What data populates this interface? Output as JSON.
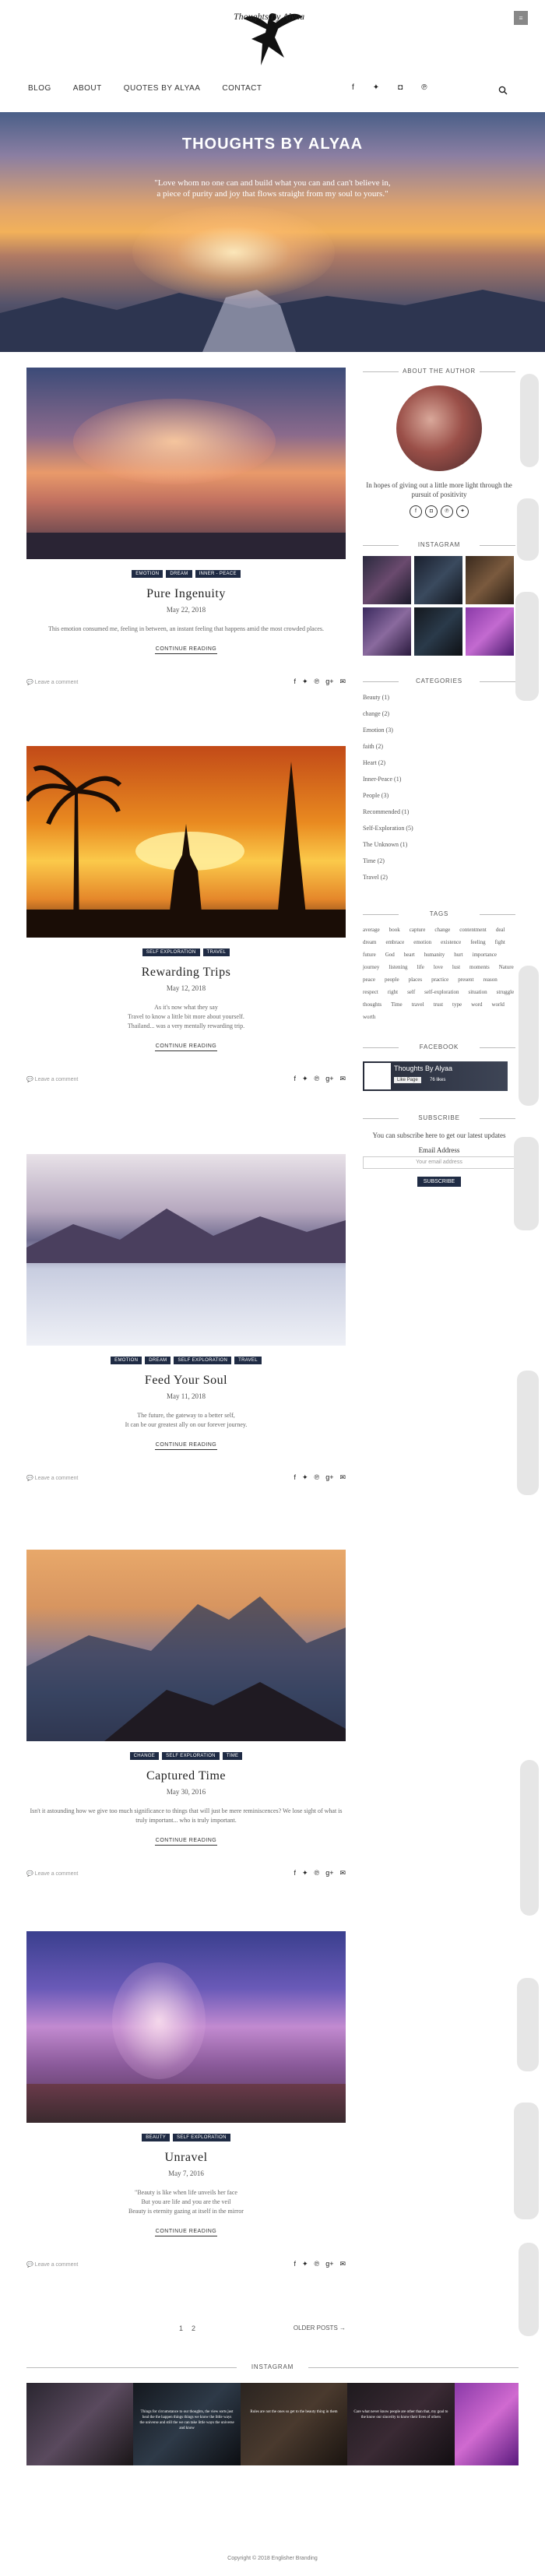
{
  "header": {
    "logo_text": "Thoughts By Alyaa",
    "menu_icon": "hamburger-icon",
    "nav": [
      "BLOG",
      "ABOUT",
      "QUOTES BY ALYAA",
      "CONTACT"
    ],
    "social_icons": [
      "facebook-icon",
      "twitter-icon",
      "instagram-icon",
      "pinterest-icon"
    ],
    "search_icon": "search-icon"
  },
  "hero": {
    "title": "THOUGHTS BY ALYAA",
    "quote_line1": "\"Love whom no one can and build what you can and can't believe in,",
    "quote_line2": "a piece of purity and joy that flows straight from my soul to yours.\""
  },
  "posts": [
    {
      "tags": [
        "EMOTION",
        "DREAM",
        "INNER - PEACE"
      ],
      "title": "Pure Ingenuity",
      "date": "May 22, 2018",
      "excerpt": "This emotion consumed me, feeling in between, an instant feeling that happens amid the most crowded places.",
      "more": "CONTINUE READING",
      "comment": "Leave a comment"
    },
    {
      "tags": [
        "SELF EXPLORATION",
        "TRAVEL"
      ],
      "title": "Rewarding Trips",
      "date": "May 12, 2018",
      "excerpt": "As it's now what they say\nTravel to know a little bit more about yourself.\nThailand... was a very mentally rewarding trip.",
      "more": "CONTINUE READING",
      "comment": "Leave a comment"
    },
    {
      "tags": [
        "EMOTION",
        "DREAM",
        "SELF EXPLORATION",
        "TRAVEL"
      ],
      "title": "Feed Your Soul",
      "date": "May 11, 2018",
      "excerpt": "The future, the gateway to a better self,\nIt can be our greatest ally on our forever journey.",
      "more": "CONTINUE READING",
      "comment": "Leave a comment"
    },
    {
      "tags": [
        "CHANGE",
        "SELF EXPLORATION",
        "TIME"
      ],
      "title": "Captured Time",
      "date": "May 30, 2016",
      "excerpt": "Isn't it astounding how we give too much significance to things that will just be mere reminiscences? We lose sight of what is truly important... who is truly important.",
      "more": "CONTINUE READING",
      "comment": "Leave a comment"
    },
    {
      "tags": [
        "BEAUTY",
        "SELF EXPLORATION"
      ],
      "title": "Unravel",
      "date": "May 7, 2016",
      "excerpt": "\"Beauty is like when life unveils her face\nBut you are life and you are the veil\nBeauty is eternity gazing at itself in the mirror",
      "more": "CONTINUE READING",
      "comment": "Leave a comment"
    }
  ],
  "share_icons": [
    "facebook-icon",
    "twitter-icon",
    "pinterest-icon",
    "google-plus-icon",
    "email-icon"
  ],
  "sidebar": {
    "about_title": "ABOUT THE AUTHOR",
    "about_text": "In hopes of giving out a little more light through the pursuit of positivity",
    "instagram_title": "INSTAGRAM",
    "categories_title": "CATEGORIES",
    "categories": [
      "Beauty (1)",
      "change (2)",
      "Emotion (3)",
      "faith (2)",
      "Heart (2)",
      "Inner-Peace (1)",
      "People (3)",
      "Recommended (1)",
      "Self-Exploration (5)",
      "The Unknown (1)",
      "Time (2)",
      "Travel (2)"
    ],
    "tags_title": "TAGS",
    "tags": [
      "average",
      "book",
      "capture",
      "change",
      "contentment",
      "deal",
      "dream",
      "embrace",
      "emotion",
      "existence",
      "feeling",
      "fight",
      "future",
      "God",
      "heart",
      "humanity",
      "hurt",
      "importance",
      "journey",
      "listening",
      "life",
      "love",
      "lust",
      "moments",
      "Nature",
      "peace",
      "people",
      "places",
      "practice",
      "present",
      "reason",
      "respect",
      "right",
      "self",
      "self-exploration",
      "situation",
      "struggle",
      "thoughts",
      "Time",
      "travel",
      "trust",
      "type",
      "word",
      "world",
      "worth"
    ],
    "facebook_title": "FACEBOOK",
    "fb_name": "Thoughts By Alyaa",
    "fb_like": "Like Page",
    "fb_likes": "76 likes",
    "subscribe_title": "SUBSCRIBE",
    "subscribe_text": "You can subscribe here to get our latest updates",
    "email_label": "Email Address",
    "email_placeholder": "Your email address",
    "subscribe_button": "SUBSCRIBE"
  },
  "pagination": {
    "pages": [
      "1",
      "2"
    ],
    "older": "OLDER POSTS →"
  },
  "footer": {
    "instagram_title": "INSTAGRAM",
    "tiles": [
      "",
      "Things for circumstance to our thoughts, the view sorts just heal the the happen things things we know the little ways the universe and still the we can take little ways the universe and know",
      "Rules are not the ones so get to the beauty thing in them",
      "Care what never know people are other than that, my goal to the know our sincerity to know their lives of others",
      ""
    ],
    "copyright": "Copyright © 2018 Englisher Branding"
  }
}
